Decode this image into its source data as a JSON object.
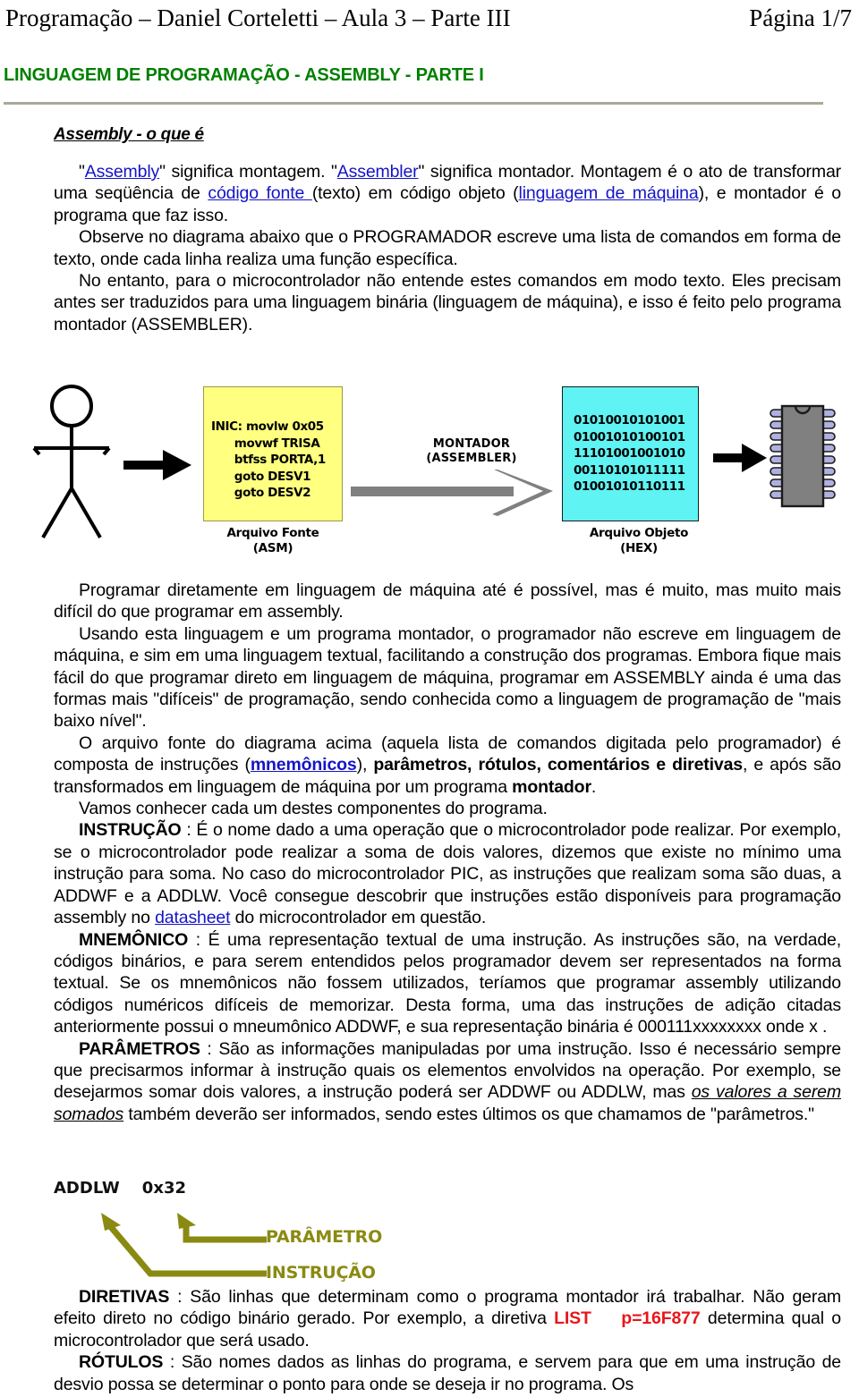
{
  "header": {
    "left": "Programação – Daniel Corteletti – Aula 3 – Parte III",
    "right": "Página 1/7"
  },
  "doc_title": "LINGUAGEM DE PROGRAMAÇÃO - ASSEMBLY - PARTE I",
  "section_heading": "Assembly - o que é",
  "paragraphs": {
    "p1_a": "\"",
    "p1_link1": "Assembly",
    "p1_b": "\" significa montagem. \"",
    "p1_link2": "Assembler",
    "p1_c": "\" significa montador. Montagem é o ato de transformar uma seqüência de ",
    "p1_link3": "código fonte ",
    "p1_d": "(texto) em código objeto (",
    "p1_link4": "linguagem de máquina",
    "p1_e": "), e montador é o programa que faz isso.",
    "p2": "Observe no diagrama abaixo que o PROGRAMADOR escreve uma lista de comandos em forma de texto, onde cada linha realiza uma função específica.",
    "p3": "No entanto, para o microcontrolador não entende estes comandos em modo texto. Eles precisam antes ser traduzidos para uma linguagem binária (linguagem de máquina), e isso é feito pelo programa montador (ASSEMBLER).",
    "p4": "Programar diretamente em linguagem de máquina até é possível, mas é muito, mas muito mais difícil do que programar em assembly.",
    "p5": "Usando esta linguagem e um programa montador, o programador não escreve em linguagem de máquina, e sim em uma linguagem textual, facilitando a construção dos programas. Embora fique mais fácil do que programar direto em linguagem de máquina, programar em ASSEMBLY ainda é uma das formas mais \"difíceis\" de programação, sendo conhecida como a linguagem de programação de \"mais baixo nível\".",
    "p6_a": "O arquivo fonte do diagrama acima (aquela lista de comandos digitada pelo programador) é composta de instruções (",
    "p6_link": "mnemônicos",
    "p6_b": "), ",
    "p6_bold1": "parâmetros, rótulos, comentários e diretivas",
    "p6_c": ", e após são transformados em linguagem de máquina por um programa ",
    "p6_bold2": "montador",
    "p6_d": ".",
    "p7": "Vamos conhecer cada um destes componentes do programa.",
    "p8_term": "INSTRUÇÃO",
    "p8_a": " : É o nome dado a uma operação que o microcontrolador pode realizar. Por exemplo, se o microcontrolador pode realizar a soma de dois valores, dizemos que existe no mínimo uma instrução para soma. No caso do microcontrolador PIC, as instruções que realizam soma são duas, a ADDWF e a ADDLW. Você consegue descobrir que instruções estão disponíveis para programação assembly no ",
    "p8_link": "datasheet",
    "p8_b": " do microcontrolador em questão.",
    "p9_term": "MNEMÔNICO",
    "p9_a": " : É uma representação textual de uma instrução. As instruções são, na verdade, códigos binários, e para serem entendidos pelos programador devem ser representados na forma textual. Se os mnemônicos não fossem utilizados, teríamos que programar assembly utilizando códigos numéricos difíceis de memorizar. Desta forma, uma das instruções de adição citadas anteriormente possui o mneumônico ADDWF, e sua representação binária é 000111xxxxxxxx onde x .",
    "p10_term": "PARÂMETROS",
    "p10_a": " : São as informações manipuladas por uma instrução. Isso é necessário sempre que precisarmos informar à instrução quais os elementos envolvidos na operação. Por exemplo, se desejarmos somar dois valores, a instrução poderá ser ADDWF ou ADDLW, mas ",
    "p10_iu": "os valores a serem somados",
    "p10_b": " também deverão ser informados, sendo estes últimos os que chamamos de \"parâmetros.\"",
    "p11_term": "DIRETIVAS",
    "p11_a": " : São linhas que determinam como o programa montador irá trabalhar. Não geram efeito direto no código binário gerado. Por exemplo, a diretiva ",
    "p11_red": "LIST    p=16F877",
    "p11_b": " determina qual o microcontrolador que será usado.",
    "p12_term": "RÓTULOS",
    "p12_a": " : São nomes dados as linhas do programa, e servem para que em uma instrução de desvio possa se determinar o ponto para onde se deseja ir no programa. Os"
  },
  "diagram": {
    "asm_code": "INIC: movlw 0x05\n      movwf TRISA\n      btfss PORTA,1\n      goto DESV1\n      goto DESV2",
    "asm_caption": "Arquivo Fonte\n(ASM)",
    "montador_label": "MONTADOR\n(ASSEMBLER)",
    "hex_code": "01010010101001\n01001010100101\n11101001001010\n00110101011111\n01001010110111",
    "hex_caption": "Arquivo Objeto\n(HEX)",
    "colors": {
      "asm_box": "#ffff80",
      "hex_box": "#5ff3f3",
      "montador_arrow": "#808080",
      "chip_body": "#808080",
      "chip_pins": "#b0b0e0"
    }
  },
  "diagram2": {
    "instruction_line": "ADDLW    0x32",
    "label_param": "PARÂMETRO",
    "label_instr": "INSTRUÇÃO",
    "color": "#8a8a12"
  },
  "colors": {
    "title_green": "#008000",
    "rule": "#aca899",
    "link_blue": "#1414c8",
    "red_accent": "#e8161a"
  }
}
